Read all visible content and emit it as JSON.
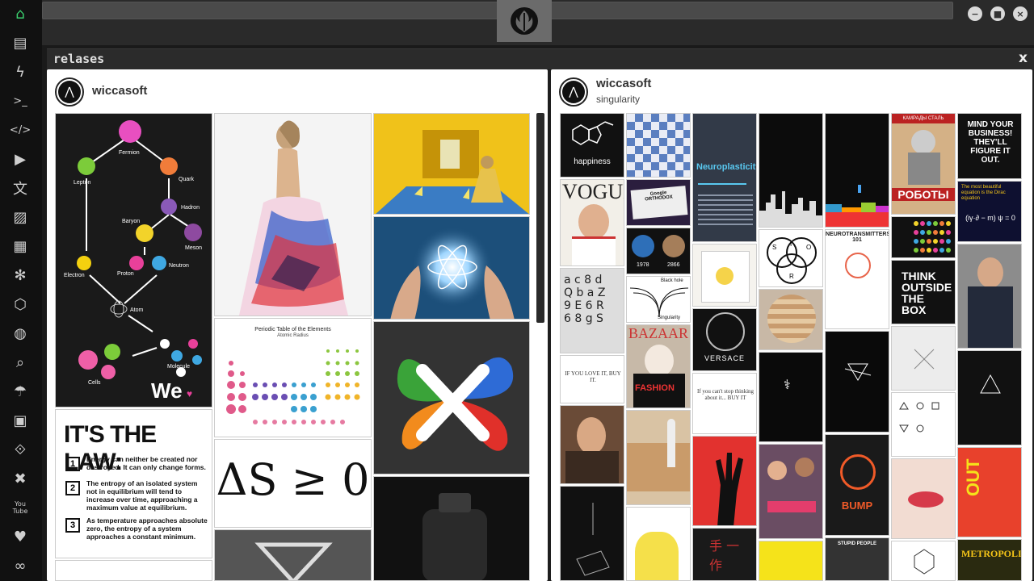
{
  "sidebar": {
    "items": [
      {
        "name": "home-icon",
        "glyph": "⌂"
      },
      {
        "name": "document-icon",
        "glyph": "▤"
      },
      {
        "name": "lightning-icon",
        "glyph": "ϟ"
      },
      {
        "name": "terminal-icon",
        "glyph": ">_"
      },
      {
        "name": "code-icon",
        "glyph": "</>"
      },
      {
        "name": "play-icon",
        "glyph": "▶"
      },
      {
        "name": "translate-icon",
        "glyph": "文"
      },
      {
        "name": "image-icon",
        "glyph": "▨"
      },
      {
        "name": "news-icon",
        "glyph": "▦"
      },
      {
        "name": "asterisk-icon",
        "glyph": "✻"
      },
      {
        "name": "hexagon-icon",
        "glyph": "⬡"
      },
      {
        "name": "globe-icon",
        "glyph": "◍"
      },
      {
        "name": "search-icon",
        "glyph": "⌕"
      },
      {
        "name": "umbrella-icon",
        "glyph": "☂"
      },
      {
        "name": "contact-icon",
        "glyph": "▣"
      },
      {
        "name": "link-icon",
        "glyph": "⟐"
      },
      {
        "name": "expand-icon",
        "glyph": "✖"
      },
      {
        "name": "youtube-icon",
        "glyph": "You\nTube"
      },
      {
        "name": "heart-icon",
        "glyph": "♥"
      },
      {
        "name": "infinity-icon",
        "glyph": "∞"
      }
    ]
  },
  "panel": {
    "title": "relases",
    "close_label": "x"
  },
  "left_card": {
    "name": "wiccasoft"
  },
  "right_card": {
    "name": "wiccasoft",
    "subtitle": "singularity"
  },
  "tiles": {
    "fermion": "Fermion",
    "lepton": "Lepton",
    "quark": "Quark",
    "hadron": "Hadron",
    "baryon": "Baryon",
    "meson": "Meson",
    "electron": "Electron",
    "proton": "Proton",
    "neutron": "Neutron",
    "atom": "Atom",
    "cells": "Cells",
    "molecule": "Molecule",
    "we": "We",
    "law_title": "IT'S THE LAW:",
    "law_1": "Energy can neither be created nor destroyed. It can only change forms.",
    "law_2": "The entropy of an isolated system not in equilibrium will tend to increase over time, approaching a maximum value at equilibrium.",
    "law_3": "As temperature approaches absolute zero, the entropy of a system approaches a constant minimum.",
    "periodic_title": "Periodic Table of the Elements",
    "periodic_sub": "Atomic Radius",
    "entropy": "ΔS ≥ 0",
    "happiness": "happiness",
    "neuroplasticity": "Neuroplasticity",
    "roboty_top": "КАМРАДЫ СТАЛЬ",
    "roboty": "РОБОТЫ",
    "mind1": "MIND YOUR BUSINESS! THEY'LL FIGURE IT OUT.",
    "dirac1": "The most beautiful equation is the Dirac equation",
    "dirac_eq": "(iγ·∂ − m) ψ = 0",
    "neurotrans": "NEUROTRANSMITTERS 101",
    "think": "THINK OUTSIDE THE BOX",
    "year1": "1978",
    "year2": "2866",
    "blackhole": "Black hole",
    "singularity": "Singularity",
    "love_it": "IF YOU LOVE IT, BUY IT.",
    "cant_stop": "If you can't stop thinking about it... BUY IT",
    "versace": "VERSACE",
    "fashion": "FASHION",
    "stupid": "STUPID PEOPLE",
    "bump": "BUMP"
  }
}
